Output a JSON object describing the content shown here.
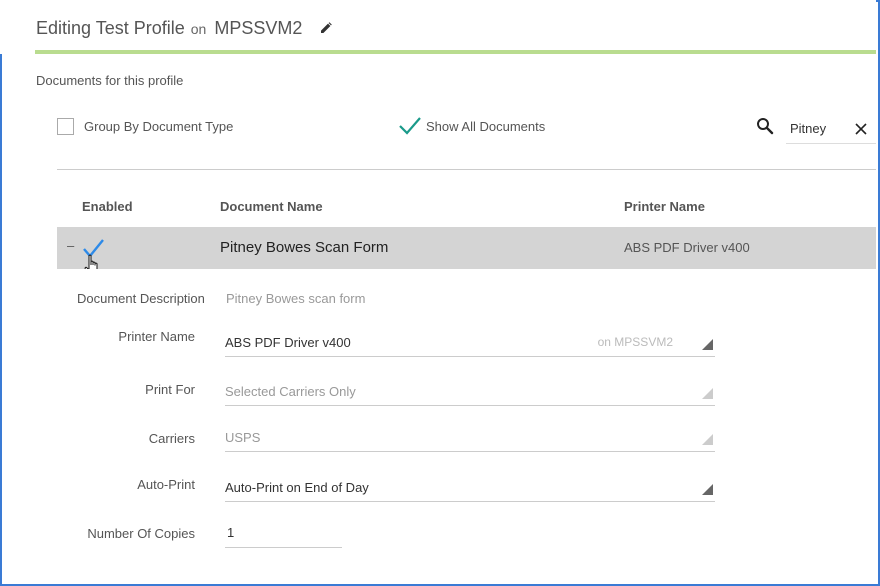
{
  "header": {
    "title": "Editing Test Profile",
    "on_label": "on",
    "host": "MPSSVM2"
  },
  "section_label": "Documents for this profile",
  "options": {
    "group_by_label": "Group By Document Type",
    "group_by_checked": false,
    "show_all_label": "Show All Documents",
    "show_all_checked": true
  },
  "search": {
    "value": "Pitney"
  },
  "table": {
    "columns": [
      "Enabled",
      "Document Name",
      "Printer Name"
    ],
    "rows": [
      {
        "expand_marker": "–",
        "enabled": true,
        "document_name": "Pitney Bowes Scan Form",
        "printer_name": "ABS PDF Driver v400"
      }
    ]
  },
  "detail": {
    "description_label": "Document Description",
    "description_value": "Pitney Bowes scan form",
    "printer_label": "Printer Name",
    "printer_value": "ABS PDF Driver v400",
    "printer_host_hint": "on MPSSVM2",
    "print_for_label": "Print For",
    "print_for_value": "Selected Carriers Only",
    "carriers_label": "Carriers",
    "carriers_value": "USPS",
    "auto_print_label": "Auto-Print",
    "auto_print_value": "Auto-Print on End of Day",
    "copies_label": "Number Of Copies",
    "copies_value": "1"
  },
  "colors": {
    "frame_border": "#3a7bd5",
    "header_rule": "#b9dc8f",
    "check_teal": "#1a9a8a",
    "check_blue": "#2d8ae8",
    "selected_row": "#d4d4d4"
  }
}
